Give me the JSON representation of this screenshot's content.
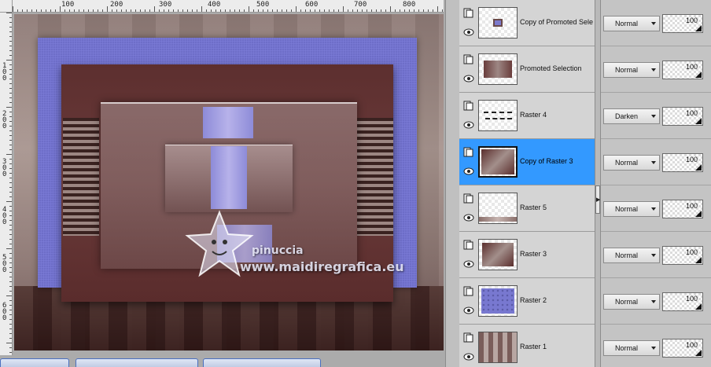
{
  "ruler": {
    "top_labels": [
      "100",
      "200",
      "300",
      "400",
      "500",
      "600",
      "700",
      "800"
    ],
    "left_labels": [
      "100",
      "200",
      "300",
      "400",
      "500",
      "600"
    ]
  },
  "watermark": {
    "name": "pinuccia",
    "url": "www.maidiregrafica.eu"
  },
  "layers": [
    {
      "name": "Copy of Promoted Sele",
      "blend": "Normal",
      "opacity": "100",
      "active": false,
      "thumb": "promoted-copy"
    },
    {
      "name": "Promoted Selection",
      "blend": "Normal",
      "opacity": "100",
      "active": false,
      "thumb": "promoted"
    },
    {
      "name": "Raster 4",
      "blend": "Darken",
      "opacity": "100",
      "active": false,
      "thumb": "raster4"
    },
    {
      "name": "Copy of Raster 3",
      "blend": "Normal",
      "opacity": "100",
      "active": true,
      "thumb": "raster3-copy"
    },
    {
      "name": "Raster 5",
      "blend": "Normal",
      "opacity": "100",
      "active": false,
      "thumb": "raster5"
    },
    {
      "name": "Raster 3",
      "blend": "Normal",
      "opacity": "100",
      "active": false,
      "thumb": "raster3"
    },
    {
      "name": "Raster 2",
      "blend": "Normal",
      "opacity": "100",
      "active": false,
      "thumb": "raster2"
    },
    {
      "name": "Raster 1",
      "blend": "Normal",
      "opacity": "100",
      "active": false,
      "thumb": "raster1"
    }
  ],
  "colors": {
    "selection": "#3399ff",
    "blue_frame": "#7272cc",
    "dark_panel": "#5d2f2f"
  }
}
